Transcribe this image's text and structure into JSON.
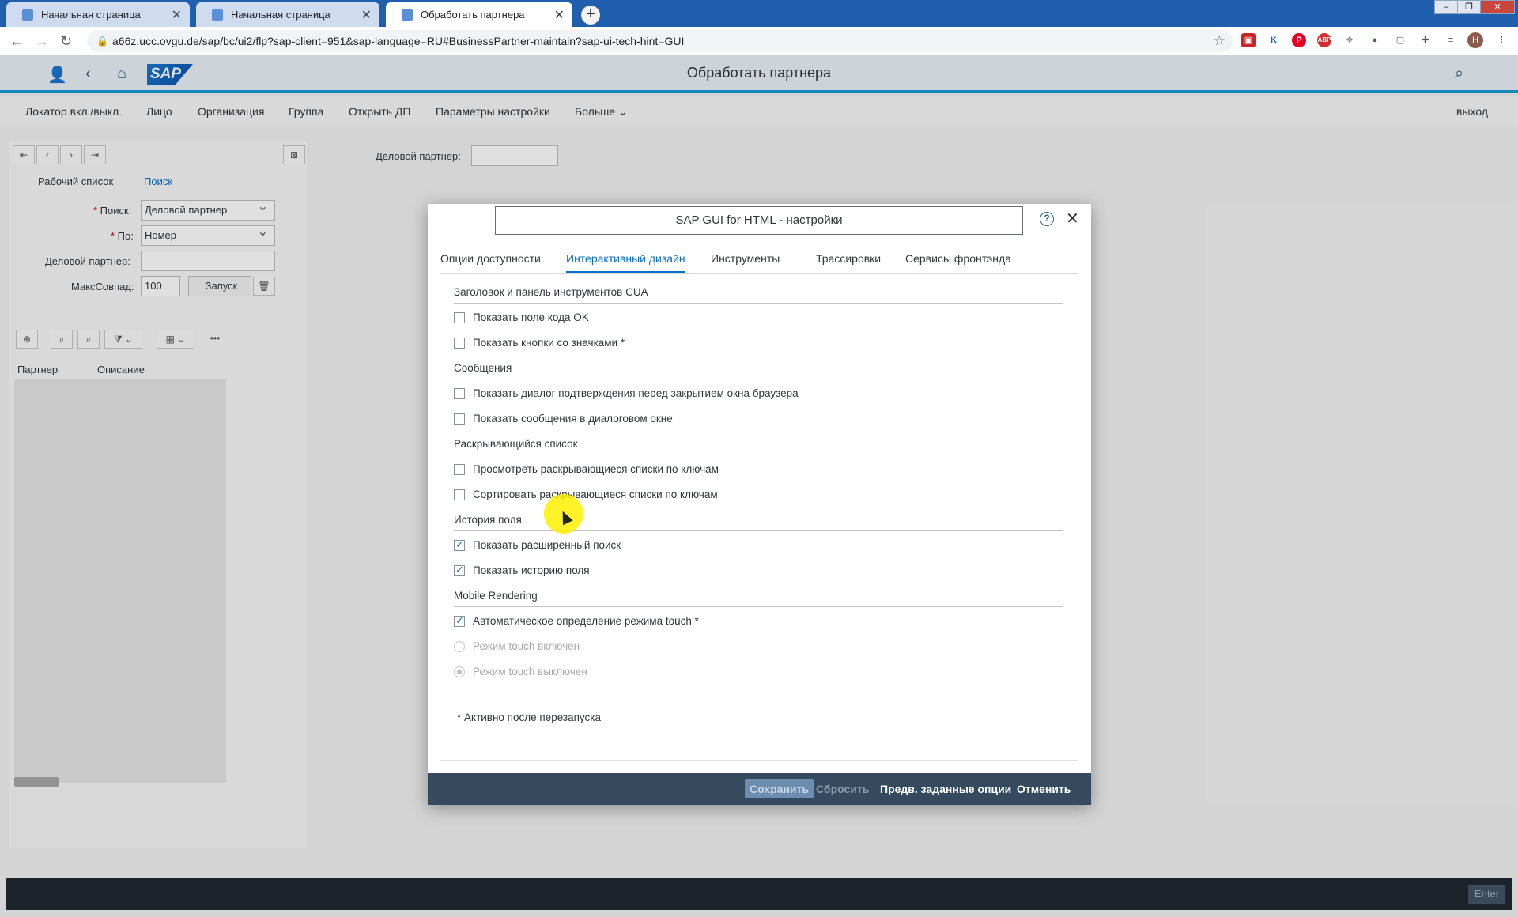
{
  "browser": {
    "tabs": [
      {
        "label": "Начальная страница"
      },
      {
        "label": "Начальная страница"
      },
      {
        "label": "Обработать партнера"
      }
    ],
    "url": "a66z.ucc.ovgu.de/sap/bc/ui2/flp?sap-client=951&sap-language=RU#BusinessPartner-maintain?sap-ui-tech-hint=GUI",
    "avatar_initial": "H"
  },
  "shell": {
    "logo": "SAP",
    "title": "Обработать партнера"
  },
  "menu": {
    "items": [
      "Локатор вкл./выкл.",
      "Лицо",
      "Организация",
      "Группа",
      "Открыть ДП",
      "Параметры настройки",
      "Больше"
    ],
    "exit": "выход"
  },
  "background": {
    "partner_label": "Деловой партнер:",
    "worklist_tab": "Рабочий список",
    "search_tab": "Поиск",
    "search_label": "Поиск:",
    "search_value": "Деловой партнер",
    "by_label": "По:",
    "by_value": "Номер",
    "bp_label": "Деловой партнер:",
    "max_label": "МаксСовпад:",
    "max_value": "100",
    "run_button": "Запуск",
    "col_partner": "Партнер",
    "col_description": "Описание"
  },
  "dialog": {
    "title": "SAP GUI for HTML - настройки",
    "tabs": [
      "Опции доступности",
      "Интерактивный дизайн",
      "Инструменты",
      "Трассировки",
      "Сервисы фронтэнда"
    ],
    "sections": {
      "cua": "Заголовок и панель инструментов CUA",
      "messages": "Сообщения",
      "dropdown": "Раскрывающийся список",
      "history": "История поля",
      "mobile": "Mobile Rendering"
    },
    "options": {
      "ok_code": "Показать поле кода OK",
      "icon_buttons": "Показать кнопки со значками *",
      "confirm_close": "Показать диалог подтверждения перед закрытием окна браузера",
      "messages_dialog": "Показать сообщения в диалоговом окне",
      "view_keys": "Просмотреть раскрывающиеся списки по ключам",
      "sort_keys": "Сортировать раскрывающиеся списки по ключам",
      "extended_search": "Показать расширенный поиск",
      "field_history": "Показать историю поля",
      "touch_auto": "Автоматическое определение режима touch *",
      "touch_on": "Режим touch включен",
      "touch_off": "Режим touch выключен"
    },
    "footnote": "* Активно после перезапуска",
    "buttons": {
      "save": "Сохранить",
      "reset": "Сбросить",
      "defaults": "Предв. заданные опции",
      "cancel": "Отменить"
    }
  },
  "status": {
    "enter": "Enter"
  },
  "colors": {
    "accent": "#0a6ed1",
    "footer": "#354a5f",
    "shell_bar_line": "#1a9ed9"
  }
}
